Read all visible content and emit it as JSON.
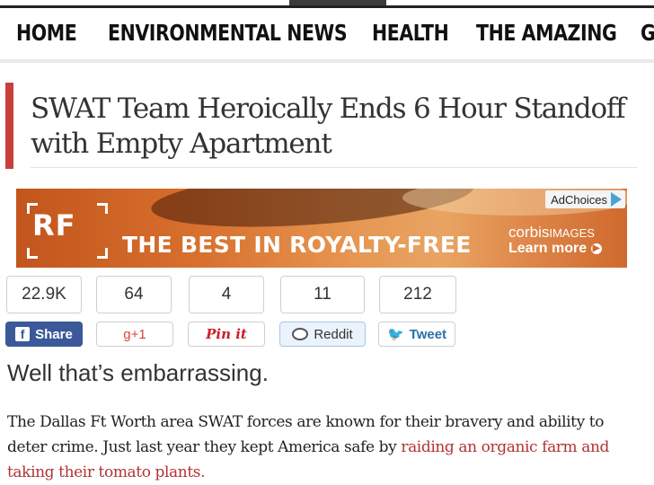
{
  "nav": {
    "items": [
      "HOME",
      "ENVIRONMENTAL NEWS",
      "HEALTH",
      "THE AMAZING",
      "G"
    ]
  },
  "article": {
    "title": "SWAT Team Heroically Ends 6 Hour Standoff with Empty Apartment",
    "subheading": "Well that’s embarrassing.",
    "body_text": "The Dallas Ft Worth area SWAT forces are known for their bravery and ability to deter crime. Just last year they kept America safe by ",
    "body_link": "raiding an organic farm and taking their tomato plants."
  },
  "ad": {
    "rf_logo": "RF",
    "slogan": "THE BEST IN ROYALTY-FREE",
    "adchoices": "AdChoices",
    "brand": "corbis",
    "brand_suffix": "IMAGES",
    "cta": "Learn more"
  },
  "share": {
    "counts": [
      "22.9K",
      "64",
      "4",
      "11",
      "212"
    ],
    "buttons": {
      "facebook": "Share",
      "gplus": "g+1",
      "pinterest": "Pin it",
      "reddit": "Reddit",
      "twitter": "Tweet"
    }
  },
  "colors": {
    "accent_bar": "#c8403c",
    "link": "#b33333",
    "facebook": "#3b5998",
    "twitter": "#55acee"
  }
}
